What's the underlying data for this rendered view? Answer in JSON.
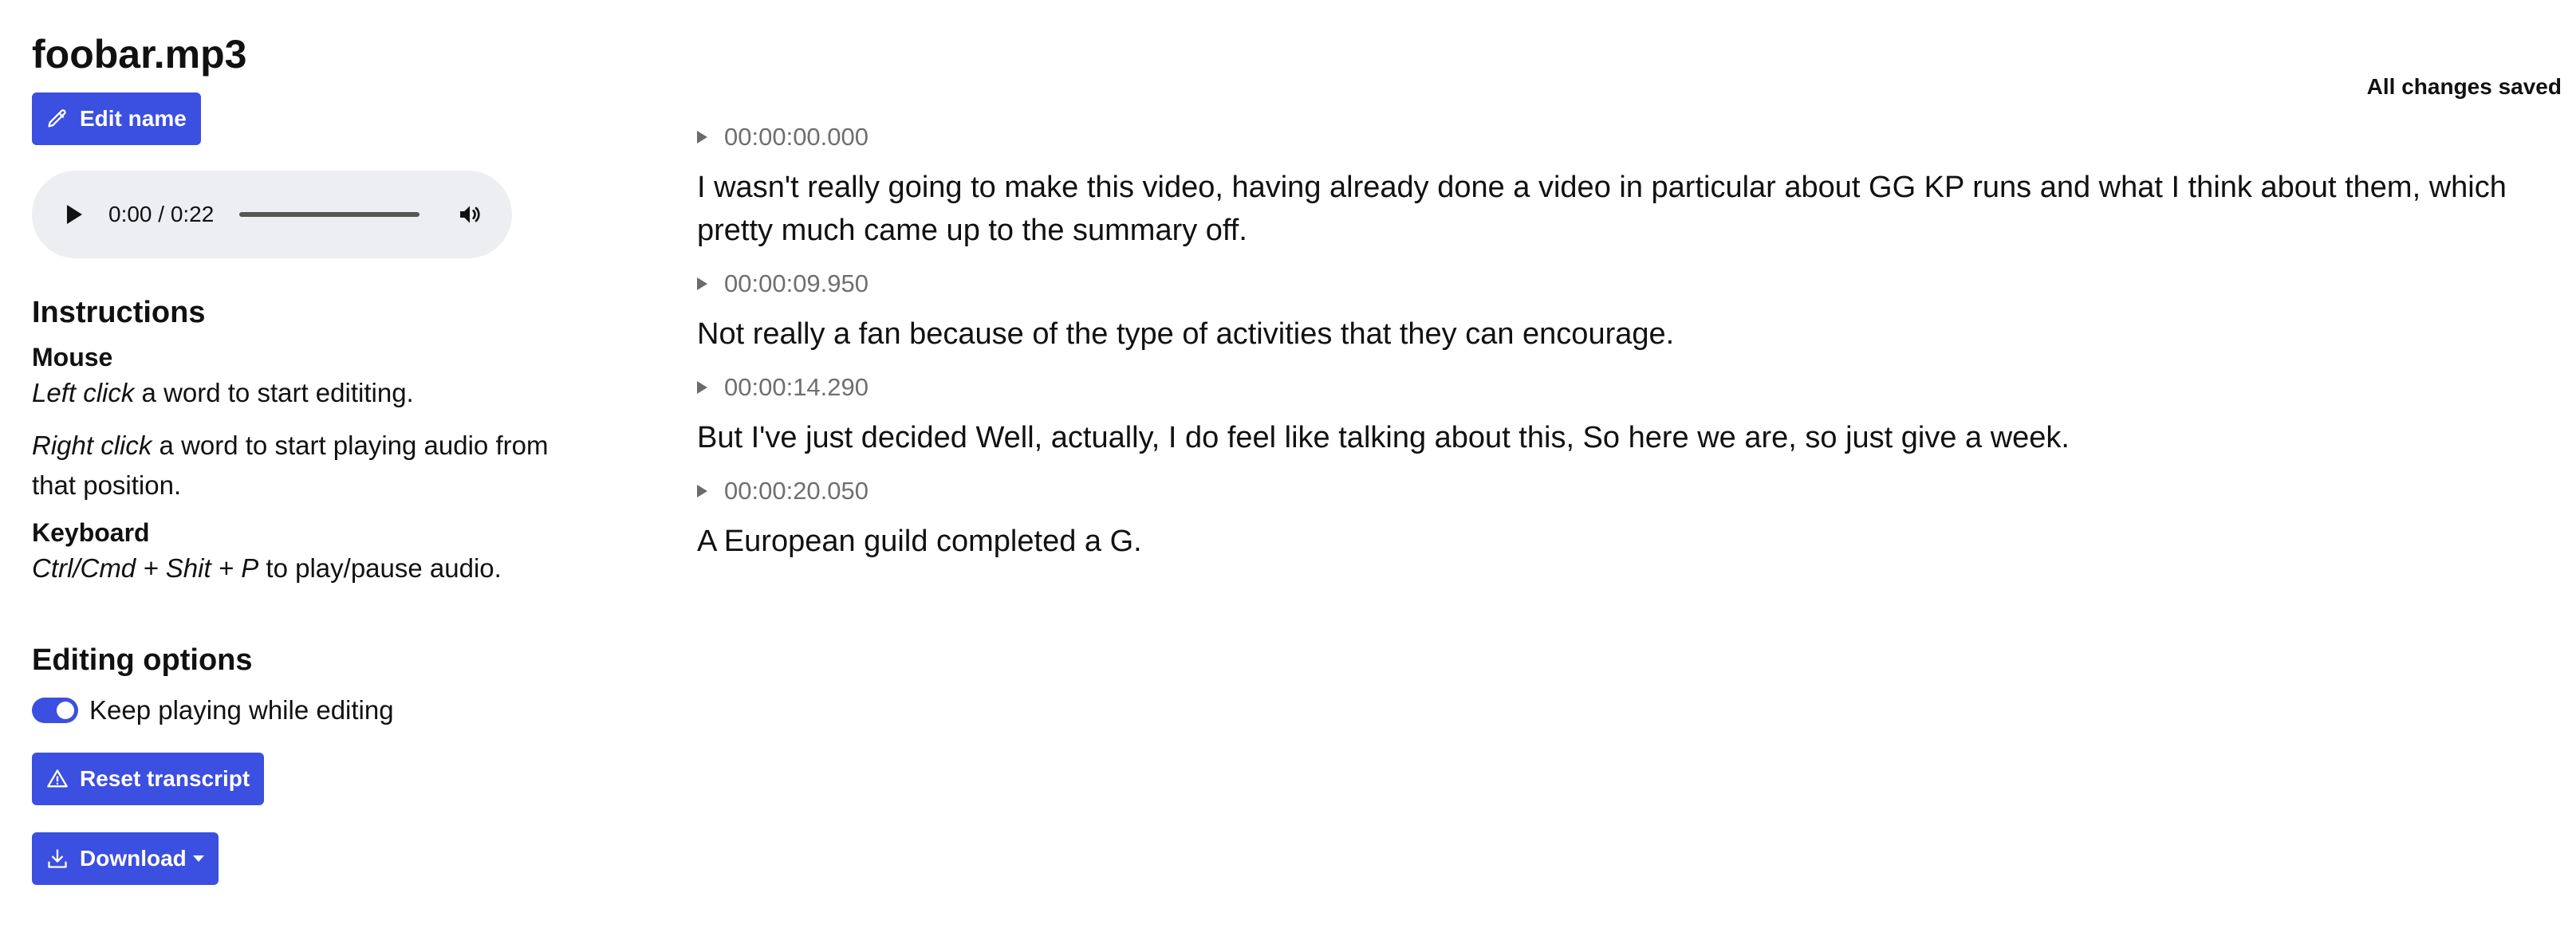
{
  "file": {
    "title": "foobar.mp3",
    "edit_name_label": "Edit name"
  },
  "player": {
    "time": "0:00 / 0:22",
    "progress": 0
  },
  "instructions": {
    "heading": "Instructions",
    "mouse": {
      "heading": "Mouse",
      "left_click_em": "Left click",
      "left_click_rest": " a word to start edititing.",
      "right_click_em": "Right click",
      "right_click_rest": " a word to start playing audio from that position."
    },
    "keyboard": {
      "heading": "Keyboard",
      "shortcut_em": "Ctrl/Cmd + Shit + P",
      "shortcut_rest": " to play/pause audio."
    }
  },
  "editing": {
    "heading": "Editing options",
    "keep_playing_label": "Keep playing while editing",
    "keep_playing_on": true,
    "reset_label": "Reset transcript",
    "download_label": "Download"
  },
  "status": {
    "save_text": "All changes saved"
  },
  "transcript": {
    "segments": [
      {
        "time": "00:00:00.000",
        "text": "I wasn't really going to make this video, having already done a video in particular about GG KP runs and what I think about them, which pretty much came up to the summary off."
      },
      {
        "time": "00:00:09.950",
        "text": "Not really a fan because of the type of activities that they can encourage."
      },
      {
        "time": "00:00:14.290",
        "text": "But I've just decided Well, actually, I do feel like talking about this, So here we are, so just give a week."
      },
      {
        "time": "00:00:20.050",
        "text": "A European guild completed a G."
      }
    ]
  },
  "icons": {
    "edit": "pencil-icon",
    "play": "play-icon",
    "volume": "volume-icon",
    "reset": "warning-triangle-icon",
    "download": "download-icon",
    "segment_play": "triangle-right-icon"
  },
  "colors": {
    "accent": "#3b4fe0",
    "player_bg": "#eceef1",
    "timestamp": "#6f6f6f"
  }
}
